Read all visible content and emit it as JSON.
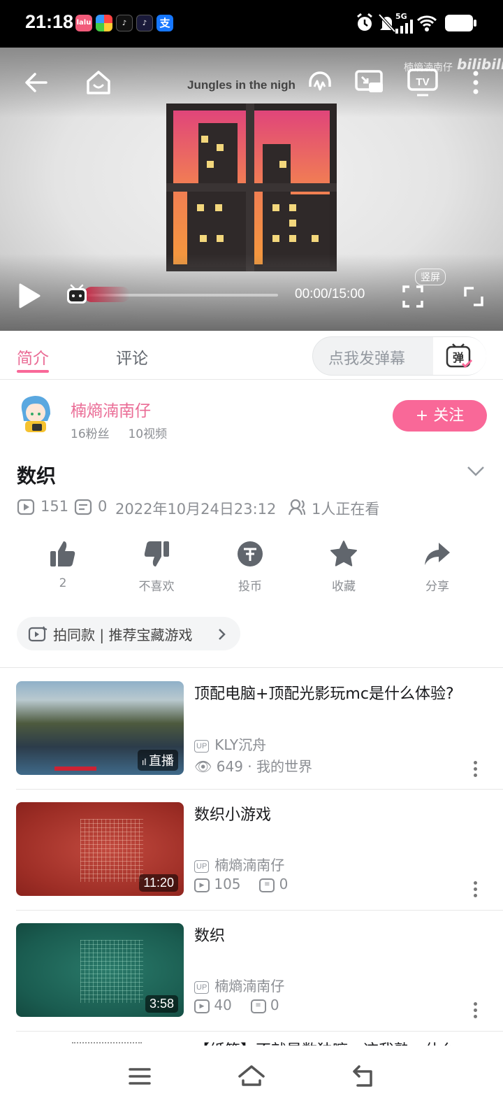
{
  "status_bar": {
    "time": "21:18",
    "network": "5G",
    "apps": [
      "lalu",
      "photos",
      "tiktok",
      "tiktok2",
      "alipay"
    ]
  },
  "player": {
    "title": "Jungles in the nigh",
    "watermark_text": "楠熵湳南仔",
    "watermark_logo": "bilibili",
    "time": "00:00/15:00",
    "vertical_label": "竖屏",
    "progress_fraction": 0.0
  },
  "tabs": {
    "intro": "简介",
    "comments": "评论",
    "danmaku_placeholder": "点我发弹幕",
    "danmaku_icon_char": "弹"
  },
  "uploader": {
    "name": "楠熵湳南仔",
    "fans": "16粉丝",
    "videos": "10视频",
    "follow_label": "+ 关注"
  },
  "video": {
    "title": "数织",
    "views": "151",
    "danmaku_count": "0",
    "date": "2022年10月24日23:12",
    "watching": "1人正在看"
  },
  "actions": [
    {
      "label": "2",
      "icon": "thumbs-up-icon"
    },
    {
      "label": "不喜欢",
      "icon": "thumbs-down-icon"
    },
    {
      "label": "投币",
      "icon": "coin-icon"
    },
    {
      "label": "收藏",
      "icon": "star-icon"
    },
    {
      "label": "分享",
      "icon": "share-icon"
    }
  ],
  "recommend_chip": "拍同款 | 推荐宝藏游戏",
  "related": [
    {
      "title": "顶配电脑+顶配光影玩mc是什么体验?",
      "badge": "直播",
      "up": "KLY沉舟",
      "views": "649",
      "extra": "· 我的世界"
    },
    {
      "title": "数织小游戏",
      "duration": "11:20",
      "up": "楠熵湳南仔",
      "views": "105",
      "danmaku": "0"
    },
    {
      "title": "数织",
      "duration": "3:58",
      "up": "楠熵湳南仔",
      "views": "40",
      "danmaku": "0"
    },
    {
      "title": "【纸笔】不就是数独嘛，这我熟。什么"
    }
  ],
  "up_tag": "UP",
  "colors": {
    "accent": "#f96898",
    "accent_text": "#ea6b95",
    "muted": "#8b8e93"
  }
}
